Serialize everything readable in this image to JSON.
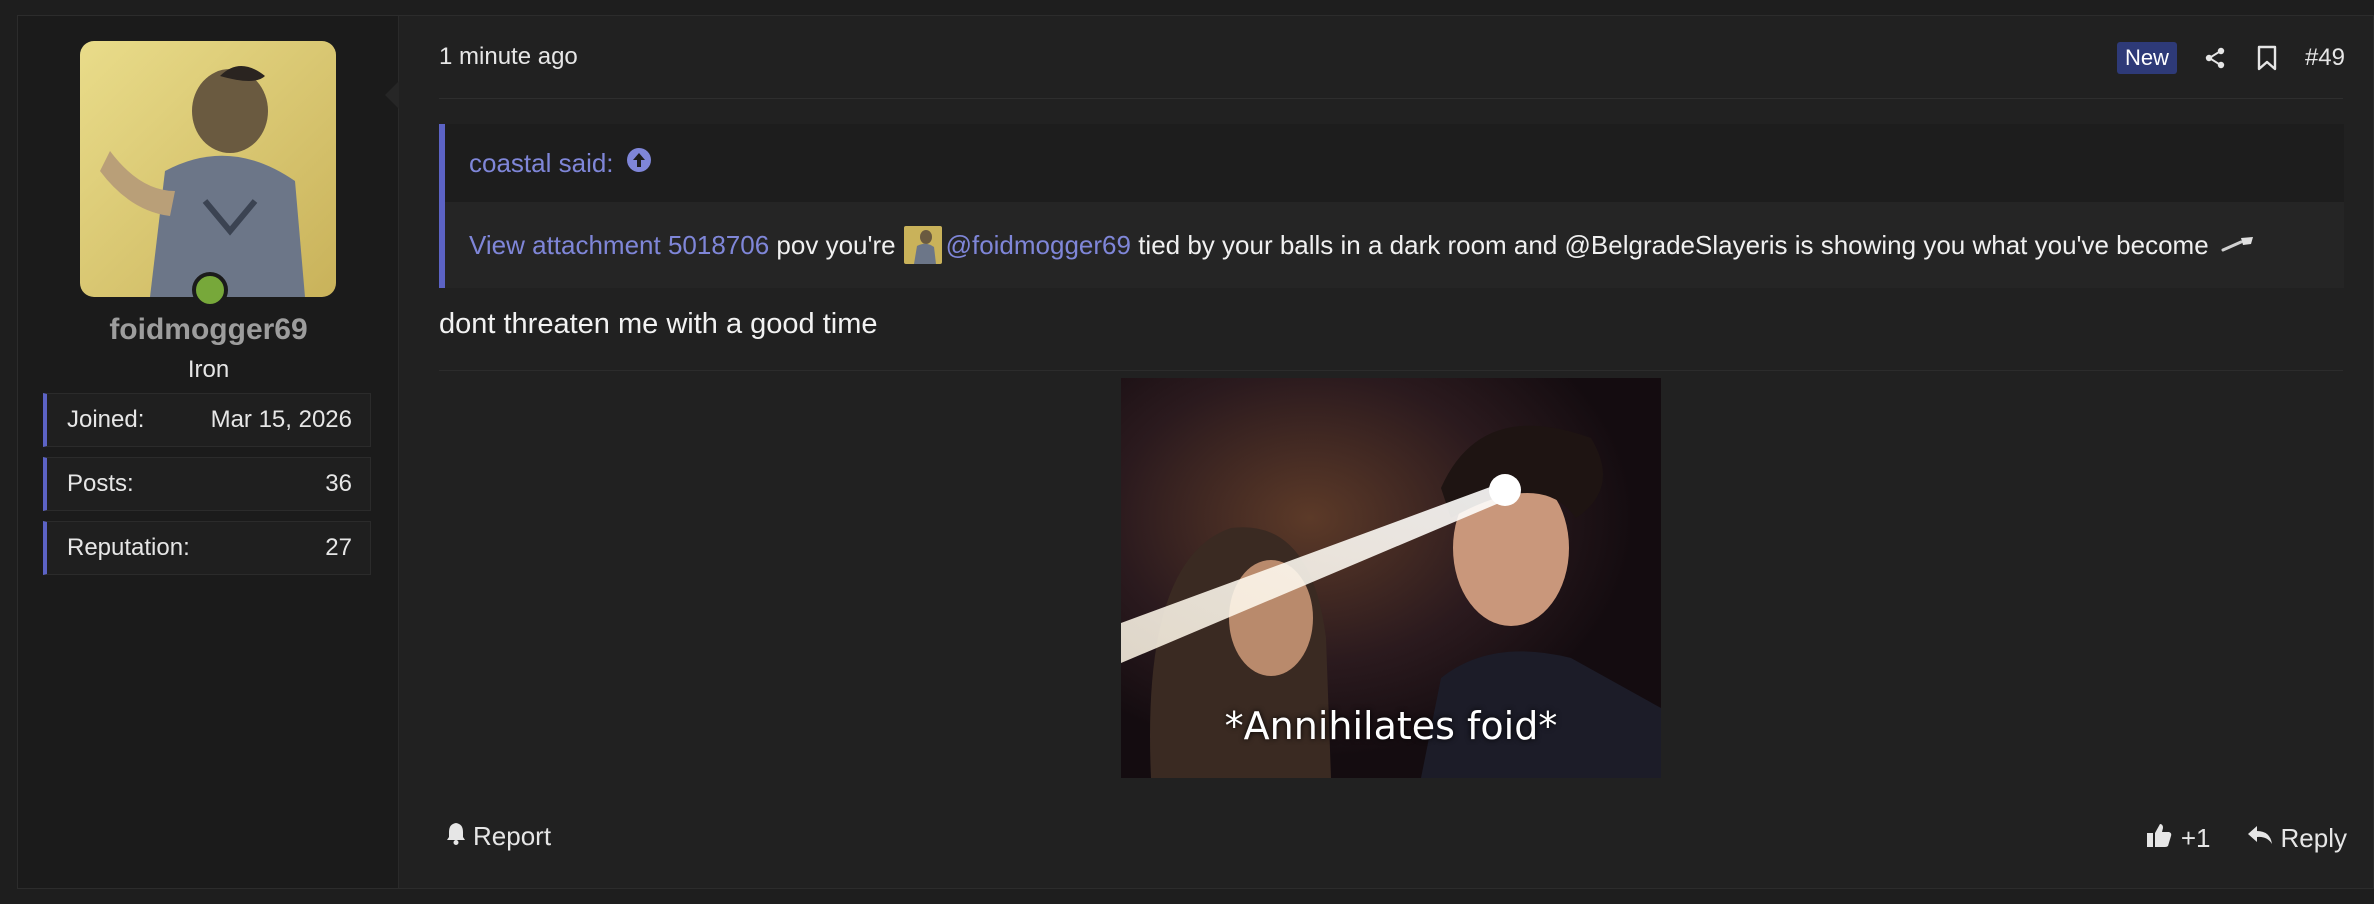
{
  "user": {
    "username": "foidmogger69",
    "title": "Iron",
    "avatar_icon": "avatar-photo",
    "online_color": "#77a83a",
    "stats": [
      {
        "label": "Joined:",
        "value": "Mar 15, 2026"
      },
      {
        "label": "Posts:",
        "value": "36"
      },
      {
        "label": "Reputation:",
        "value": "27"
      }
    ]
  },
  "post": {
    "timestamp": "1 minute ago",
    "badge": "New",
    "number": "#49",
    "accent": "#5c63c5",
    "link_color": "#7f86d8"
  },
  "quote": {
    "author": "coastal said:",
    "attachment": "View attachment 5018706",
    "text_1": "pov you're",
    "mention": "@foidmogger69",
    "text_2": "tied by your balls in a dark room and @BelgradeSlayeris is showing you what you've become"
  },
  "reply": {
    "text": "dont threaten me with a good time"
  },
  "image": {
    "caption": "*Annihilates foid*"
  },
  "footer": {
    "report_label": "Report",
    "reaction_count": "+1",
    "reply_label": "Reply"
  }
}
